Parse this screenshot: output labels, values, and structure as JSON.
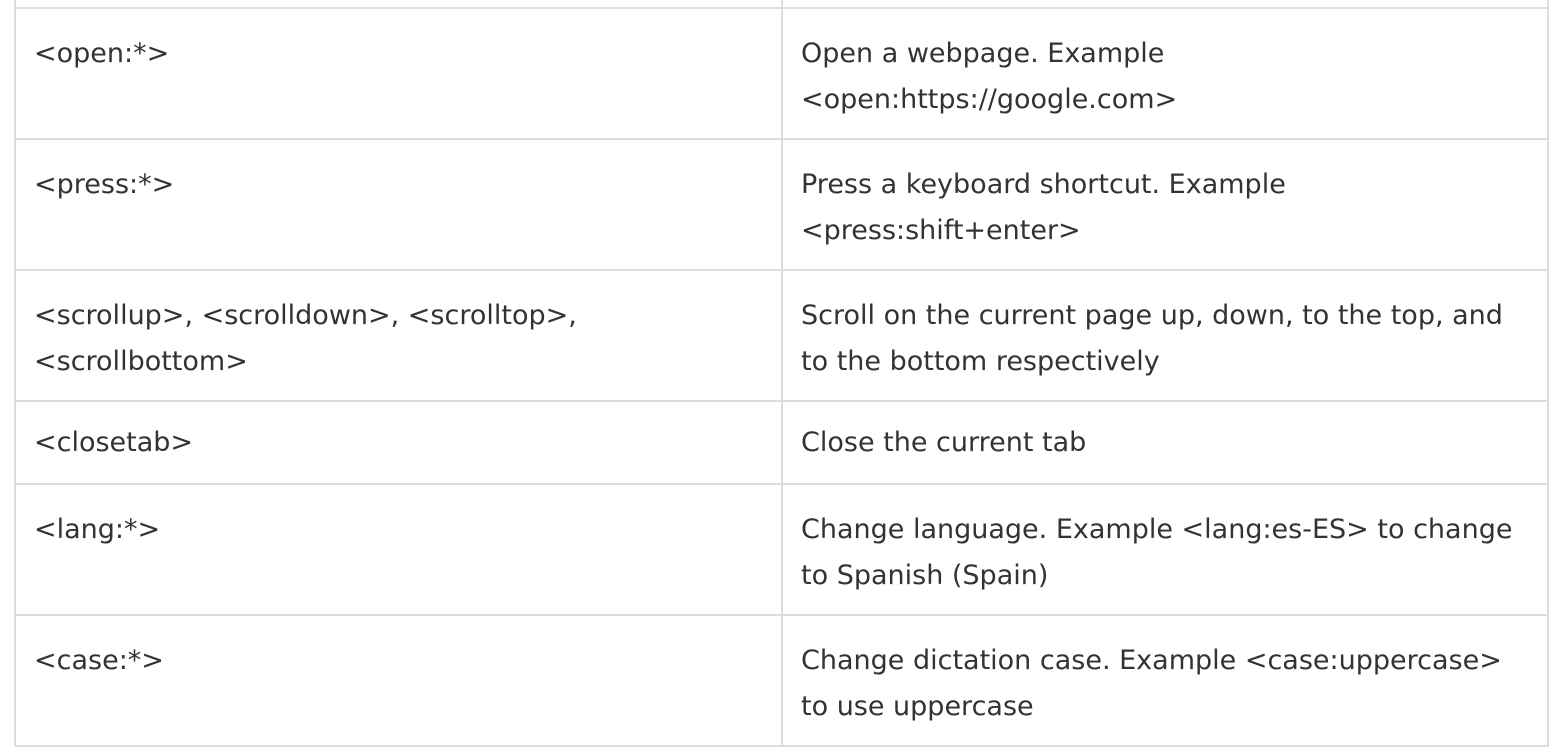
{
  "table": {
    "rows": [
      {
        "command": "",
        "description": ""
      },
      {
        "command": "<open:*>",
        "description": "Open a webpage. Example <open:https://google.com>"
      },
      {
        "command": "<press:*>",
        "description": "Press a keyboard shortcut. Example <press:shift+enter>"
      },
      {
        "command": "<scrollup>, <scrolldown>, <scrolltop>, <scrollbottom>",
        "description": "Scroll on the current page up, down, to the top, and to the bottom respectively"
      },
      {
        "command": "<closetab>",
        "description": "Close the current tab"
      },
      {
        "command": "<lang:*>",
        "description": "Change language. Example <lang:es-ES> to change to Spanish (Spain)"
      },
      {
        "command": "<case:*>",
        "description": "Change dictation case. Example <case:uppercase> to use uppercase"
      }
    ]
  }
}
